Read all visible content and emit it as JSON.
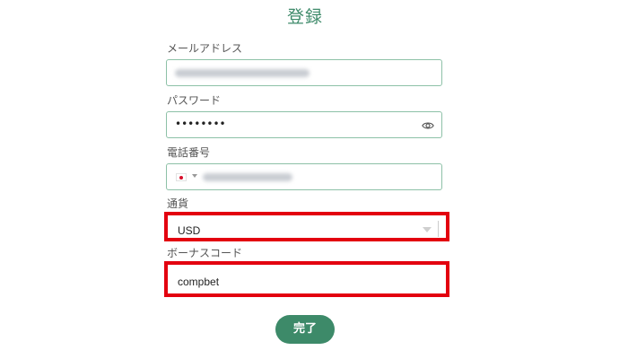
{
  "form": {
    "title": "登録",
    "email": {
      "label": "メールアドレス",
      "value_obscured": true
    },
    "password": {
      "label": "パスワード",
      "masked_value": "••••••••",
      "toggle_icon": "eye-icon"
    },
    "phone": {
      "label": "電話番号",
      "country_flag": "japan-flag-icon",
      "value_obscured": true
    },
    "currency": {
      "label": "通貨",
      "selected": "USD",
      "highlighted": true
    },
    "bonus_code": {
      "label": "ボーナスコード",
      "value": "compbet",
      "highlighted": true
    },
    "submit_label": "完了"
  },
  "colors": {
    "accent": "#3d8a69",
    "field_border": "#8dc1a7",
    "highlight": "#e3000f"
  }
}
